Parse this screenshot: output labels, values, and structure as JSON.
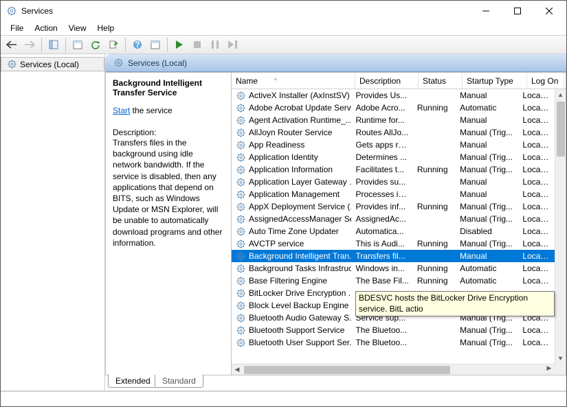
{
  "window": {
    "title": "Services"
  },
  "menu": {
    "file": "File",
    "action": "Action",
    "view": "View",
    "help": "Help"
  },
  "tree": {
    "root": "Services (Local)"
  },
  "pane_header": "Services (Local)",
  "detail": {
    "title": "Background Intelligent Transfer Service",
    "start_word": "Start",
    "start_suffix": " the service",
    "desc_label": "Description:",
    "desc_text": "Transfers files in the background using idle network bandwidth. If the service is disabled, then any applications that depend on BITS, such as Windows Update or MSN Explorer, will be unable to automatically download programs and other information."
  },
  "columns": {
    "name": "Name",
    "description": "Description",
    "status": "Status",
    "startup": "Startup Type",
    "logon": "Log On"
  },
  "selected_name": "Background Intelligent Tran...",
  "tooltip": "BDESVC hosts the BitLocker Drive Encryption service. BitL\nactio",
  "tabs": {
    "extended": "Extended",
    "standard": "Standard"
  },
  "services": [
    {
      "name": "ActiveX Installer (AxInstSV)",
      "desc": "Provides Us...",
      "status": "",
      "startup": "Manual",
      "logon": "Local Sy"
    },
    {
      "name": "Adobe Acrobat Update Serv...",
      "desc": "Adobe Acro...",
      "status": "Running",
      "startup": "Automatic",
      "logon": "Local Sy"
    },
    {
      "name": "Agent Activation Runtime_...",
      "desc": "Runtime for...",
      "status": "",
      "startup": "Manual",
      "logon": "Local Sy"
    },
    {
      "name": "AllJoyn Router Service",
      "desc": "Routes AllJo...",
      "status": "",
      "startup": "Manual (Trig...",
      "logon": "Local Se"
    },
    {
      "name": "App Readiness",
      "desc": "Gets apps re...",
      "status": "",
      "startup": "Manual",
      "logon": "Local Sy"
    },
    {
      "name": "Application Identity",
      "desc": "Determines ...",
      "status": "",
      "startup": "Manual (Trig...",
      "logon": "Local Se"
    },
    {
      "name": "Application Information",
      "desc": "Facilitates t...",
      "status": "Running",
      "startup": "Manual (Trig...",
      "logon": "Local Sy"
    },
    {
      "name": "Application Layer Gateway ...",
      "desc": "Provides su...",
      "status": "",
      "startup": "Manual",
      "logon": "Local Se"
    },
    {
      "name": "Application Management",
      "desc": "Processes in...",
      "status": "",
      "startup": "Manual",
      "logon": "Local Sy"
    },
    {
      "name": "AppX Deployment Service (...",
      "desc": "Provides inf...",
      "status": "Running",
      "startup": "Manual (Trig...",
      "logon": "Local Sy"
    },
    {
      "name": "AssignedAccessManager Se...",
      "desc": "AssignedAc...",
      "status": "",
      "startup": "Manual (Trig...",
      "logon": "Local Sy"
    },
    {
      "name": "Auto Time Zone Updater",
      "desc": "Automatica...",
      "status": "",
      "startup": "Disabled",
      "logon": "Local Se"
    },
    {
      "name": "AVCTP service",
      "desc": "This is Audi...",
      "status": "Running",
      "startup": "Manual (Trig...",
      "logon": "Local Se"
    },
    {
      "name": "Background Intelligent Tran...",
      "desc": "Transfers fil...",
      "status": "",
      "startup": "Manual",
      "logon": "Local Sy"
    },
    {
      "name": "Background Tasks Infrastruc...",
      "desc": "Windows in...",
      "status": "Running",
      "startup": "Automatic",
      "logon": "Local Sy"
    },
    {
      "name": "Base Filtering Engine",
      "desc": "The Base Fil...",
      "status": "Running",
      "startup": "Automatic",
      "logon": "Local Se"
    },
    {
      "name": "BitLocker Drive Encryption ...",
      "desc": "",
      "status": "",
      "startup": "",
      "logon": ""
    },
    {
      "name": "Block Level Backup Engine ...",
      "desc": "",
      "status": "",
      "startup": "",
      "logon": ""
    },
    {
      "name": "Bluetooth Audio Gateway S...",
      "desc": "Service sup...",
      "status": "",
      "startup": "Manual (Trig...",
      "logon": "Local Se"
    },
    {
      "name": "Bluetooth Support Service",
      "desc": "The Bluetoo...",
      "status": "",
      "startup": "Manual (Trig...",
      "logon": "Local Se"
    },
    {
      "name": "Bluetooth User Support Ser...",
      "desc": "The Bluetoo...",
      "status": "",
      "startup": "Manual (Trig...",
      "logon": "Local Sy"
    }
  ]
}
